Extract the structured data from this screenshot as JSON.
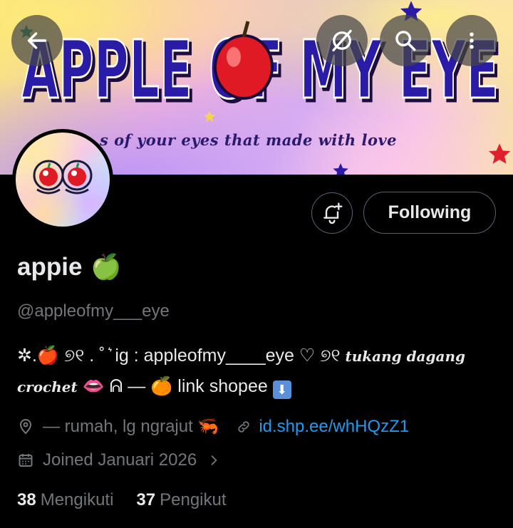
{
  "banner": {
    "title": "APPLE OF MY EYE",
    "subtitle": "s of your eyes that made with love"
  },
  "topbar": {
    "back_icon": "arrow-left-icon",
    "grok_icon": "grok-icon",
    "search_icon": "search-icon",
    "more_icon": "more-vertical-icon"
  },
  "actions": {
    "notify_icon": "bell-plus-icon",
    "follow_label": "Following"
  },
  "profile": {
    "name": "appie",
    "name_emoji": "🍏",
    "handle": "@appleofmy___eye",
    "bio_line1_prefix": "✲.🍎 ୭୧ . ˚ ͛ ig : appleofmy____eye ♡ ୭୧ ",
    "bio_line1_script": "tukang dagang",
    "bio_line2_script": "crochet",
    "bio_line2_rest": " 👄 ᕱ — 🍊 link shopee ",
    "bio_line2_icon": "⬇",
    "location": "— rumah, lg ngrajut 🦐",
    "link": "id.shp.ee/whHQzZ1",
    "joined": "Joined Januari 2026",
    "following_count": "38",
    "following_label": "Mengikuti",
    "followers_count": "37",
    "followers_label": "Pengikut"
  },
  "colors": {
    "background": "#000000",
    "text": "#e7e9ea",
    "muted": "#71767b",
    "link": "#1d9bf0",
    "banner_text": "#2a1a9e"
  }
}
